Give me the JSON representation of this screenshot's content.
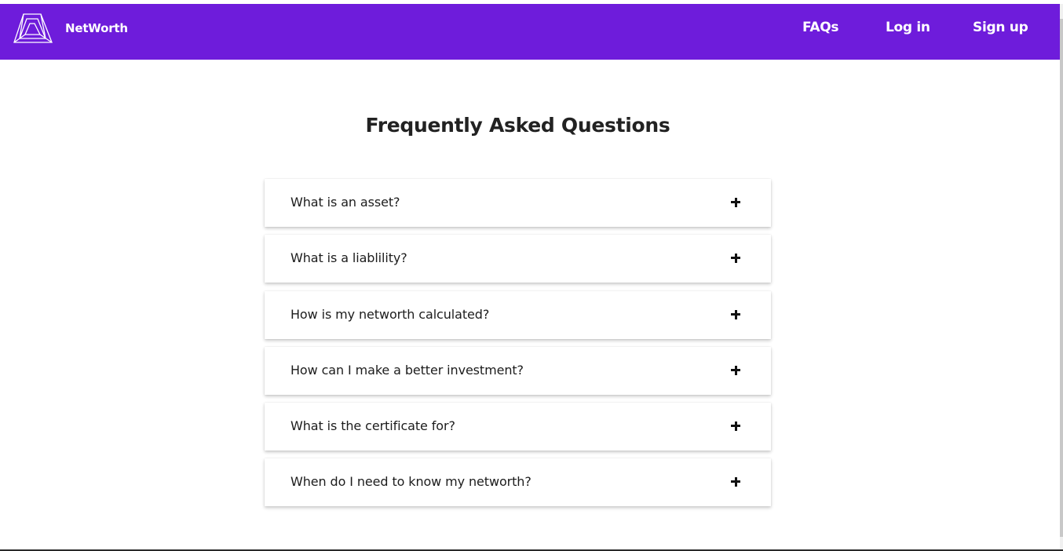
{
  "header": {
    "brand": "NetWorth",
    "logo_icon": "impossible-triangle-logo-icon",
    "nav": {
      "faqs": "FAQs",
      "login": "Log in",
      "signup": "Sign up"
    }
  },
  "main": {
    "title": "Frequently Asked Questions",
    "faqs": [
      {
        "question": "What is an asset?",
        "icon": "plus-icon"
      },
      {
        "question": "What is a liablility?",
        "icon": "plus-icon"
      },
      {
        "question": "How is my networth calculated?",
        "icon": "plus-icon"
      },
      {
        "question": "How can I make a better investment?",
        "icon": "plus-icon"
      },
      {
        "question": "What is the certificate for?",
        "icon": "plus-icon"
      },
      {
        "question": "When do I need to know my networth?",
        "icon": "plus-icon"
      }
    ]
  },
  "colors": {
    "navbar": "#6e1cdb",
    "nav_text": "#ffffff",
    "title_text": "#222222"
  }
}
